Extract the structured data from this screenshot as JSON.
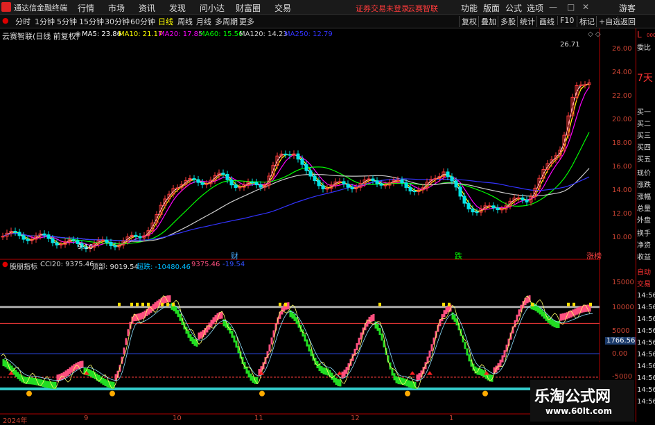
{
  "window": {
    "app_name": "通达信金融终端",
    "warning": "证券交易未登录",
    "stock_tag": "云赛智联"
  },
  "top_menu": [
    "行情",
    "市场",
    "资讯",
    "发现",
    "问小达",
    "财富圈",
    "交易"
  ],
  "top_right_menu": [
    "功能",
    "版面",
    "公式",
    "选项"
  ],
  "user": "游客",
  "periods": [
    "分时",
    "1分钟",
    "5分钟",
    "15分钟",
    "30分钟",
    "60分钟",
    "日线",
    "周线",
    "月线",
    "多周期",
    "更多"
  ],
  "active_period": "日线",
  "toolbar_buttons": [
    "复权",
    "叠加",
    "多股",
    "统计",
    "画线",
    "F10",
    "标记",
    "+自选",
    "返回"
  ],
  "main_chart": {
    "title": "云赛智联(日线 前复权)",
    "ma": [
      {
        "label": "MA5: 23.86",
        "color": "#ffffff"
      },
      {
        "label": "MA10: 21.17",
        "color": "#ffff00"
      },
      {
        "label": "MA20: 17.85",
        "color": "#ff00ff"
      },
      {
        "label": "MA60: 15.56",
        "color": "#00ff00"
      },
      {
        "label": "MA120: 14.23",
        "color": "#cccccc"
      },
      {
        "label": "MA250: 12.79",
        "color": "#3333ff"
      }
    ],
    "price_axis": [
      "26.00",
      "24.00",
      "22.00",
      "20.00",
      "18.00",
      "16.00",
      "14.00",
      "12.00",
      "10.00"
    ],
    "high_label": "26.71",
    "low_label": "9.16",
    "markers": [
      "财",
      "跌",
      "涨榜"
    ]
  },
  "indicator": {
    "title": "股朋指标",
    "values": [
      {
        "label": "CCI20: 9375.46",
        "color": "#dddddd"
      },
      {
        "label": "顶部: 9019.54",
        "color": "#dddddd"
      },
      {
        "label": "超跌: -10480.46",
        "color": "#00bfff"
      },
      {
        "label": "9375.46",
        "color": "#ff5080"
      },
      {
        "label": "-19.54",
        "color": "#3050ff"
      }
    ],
    "axis": [
      "15000",
      "10000",
      "5000",
      "0.00",
      "-5000"
    ],
    "cur_value": "1766.56"
  },
  "date_axis": [
    "2024年",
    "9",
    "10",
    "11",
    "12",
    "1"
  ],
  "side_panel": {
    "items": [
      "L",
      "委比",
      "7天",
      "买一",
      "买二",
      "买三",
      "买四",
      "买五",
      "现价",
      "涨跌",
      "涨幅",
      "总量",
      "外盘",
      "换手",
      "净资",
      "收益",
      "自动",
      "交易"
    ],
    "times": [
      "14:56",
      "14:56",
      "14:56",
      "14:56",
      "14:56",
      "14:56",
      "14:56",
      "14:56",
      "14:56",
      "14:56"
    ]
  },
  "watermark": {
    "title": "乐淘公式网",
    "url": "www.60lt.com"
  },
  "colors": {
    "up": "#ff3b3b",
    "down": "#00e5e5",
    "axis": "#b00000"
  }
}
